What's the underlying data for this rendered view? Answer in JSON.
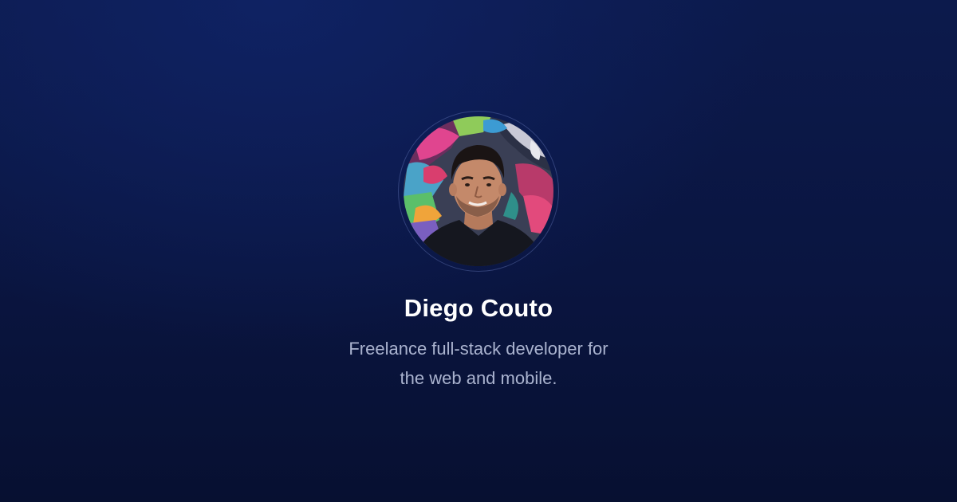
{
  "profile": {
    "name": "Diego Couto",
    "bio_line_1": "Freelance full-stack developer for",
    "bio_line_2": "the web and mobile."
  },
  "colors": {
    "background_top": "#0f2263",
    "background_bottom": "#071031",
    "name_text": "#ffffff",
    "bio_text": "#aab3cf"
  }
}
